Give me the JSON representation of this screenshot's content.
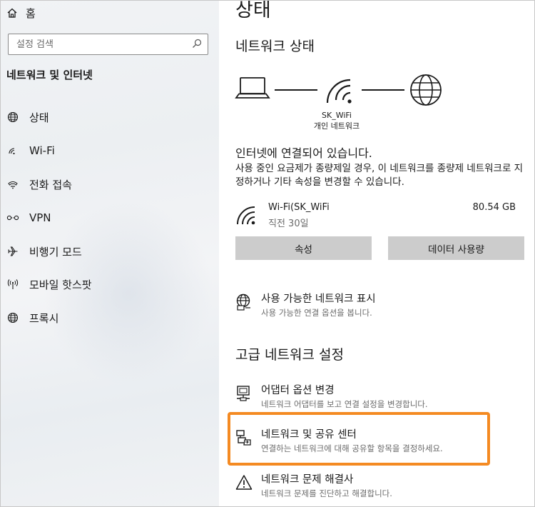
{
  "sidebar": {
    "home_label": "홈",
    "search_placeholder": "설정 검색",
    "section_title": "네트워크 및 인터넷",
    "items": [
      {
        "label": "상태",
        "icon": "globe-icon"
      },
      {
        "label": "Wi-Fi",
        "icon": "wifi-icon"
      },
      {
        "label": "전화 접속",
        "icon": "dialup-icon"
      },
      {
        "label": "VPN",
        "icon": "vpn-icon"
      },
      {
        "label": "비행기 모드",
        "icon": "airplane-icon"
      },
      {
        "label": "모바일 핫스팟",
        "icon": "hotspot-icon"
      },
      {
        "label": "프록시",
        "icon": "globe-icon"
      }
    ]
  },
  "main": {
    "page_title": "상태",
    "network_status_heading": "네트워크 상태",
    "network_name": "SK_WiFi",
    "network_type": "개인 네트워크",
    "connection_title": "인터넷에 연결되어 있습니다.",
    "connection_desc": "사용 중인 요금제가 종량제일 경우, 이 네트워크를 종량제 네트워크로 지정하거나 기타 속성을 변경할 수 있습니다.",
    "wifi": {
      "name": "Wi-Fi(SK_WiFi",
      "period": "직전 30일",
      "usage": "80.54 GB"
    },
    "buttons": {
      "properties": "속성",
      "data_usage": "데이터 사용량"
    },
    "show_networks": {
      "title": "사용 가능한 네트워크 표시",
      "desc": "사용 가능한 연결 옵션을 봅니다."
    },
    "advanced_heading": "고급 네트워크 설정",
    "adapter_options": {
      "title": "어댑터 옵션 변경",
      "desc": "네트워크 어댑터를 보고 연결 설정을 변경합니다."
    },
    "sharing_center": {
      "title": "네트워크 및 공유 센터",
      "desc": "연결하는 네트워크에 대해 공유할 항목을 결정하세요."
    },
    "troubleshooter": {
      "title": "네트워크 문제 해결사",
      "desc": "네트워크 문제를 진단하고 해결합니다."
    }
  },
  "colors": {
    "highlight": "#f48a22",
    "button_bg": "#cccccc",
    "secondary_text": "#6b6b6b"
  }
}
